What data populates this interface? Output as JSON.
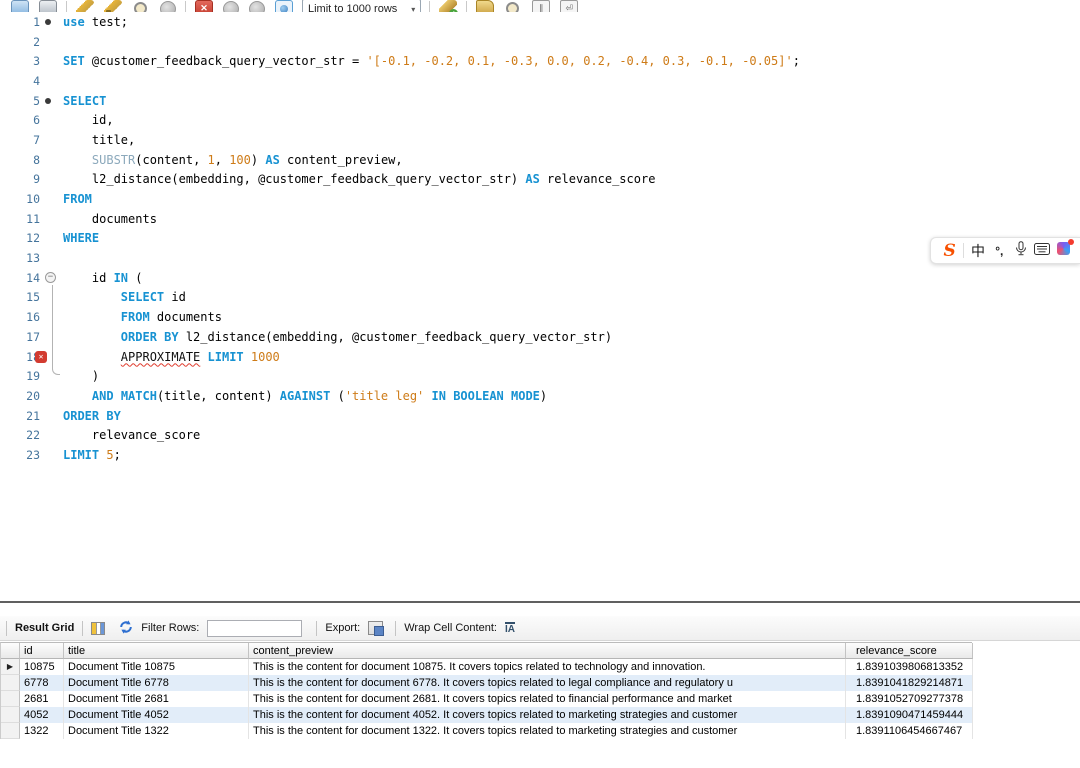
{
  "top_toolbar": {
    "limit_label": "Limit to 1000 rows",
    "icons": [
      {
        "name": "open-script-icon",
        "kind": "doc"
      },
      {
        "name": "save-script-icon",
        "kind": "floppy"
      },
      {
        "kind": "sep"
      },
      {
        "name": "execute-script-icon",
        "kind": "pencil"
      },
      {
        "name": "execute-current-statement-icon",
        "kind": "pencil2"
      },
      {
        "name": "explain-plan-icon",
        "kind": "maglight"
      },
      {
        "name": "stop-query-icon",
        "kind": "circle-gray"
      },
      {
        "kind": "sep"
      },
      {
        "name": "toggle-stop-on-error-icon",
        "kind": "red-grid"
      },
      {
        "name": "commit-icon",
        "kind": "circle-gray"
      },
      {
        "name": "rollback-icon",
        "kind": "circle-gray"
      },
      {
        "name": "toggle-autocommit-icon",
        "kind": "autocommit"
      },
      {
        "kind": "dropdown"
      },
      {
        "kind": "sep"
      },
      {
        "name": "new-snippet-icon",
        "kind": "wand"
      },
      {
        "kind": "sep"
      },
      {
        "name": "beautify-script-icon",
        "kind": "broom"
      },
      {
        "name": "find-icon",
        "kind": "magnify"
      },
      {
        "name": "invisible-chars-icon",
        "kind": "sqicon",
        "glyph": "∥"
      },
      {
        "name": "wrap-text-icon",
        "kind": "sqicon",
        "glyph": "⏎"
      }
    ]
  },
  "editor": {
    "lines": [
      {
        "n": "1",
        "m": "stmt",
        "seg": [
          [
            "k",
            "use"
          ],
          [
            "p",
            " test;"
          ]
        ]
      },
      {
        "n": "2",
        "m": "",
        "seg": []
      },
      {
        "n": "3",
        "m": "",
        "seg": [
          [
            "k",
            "SET"
          ],
          [
            "p",
            " @customer_feedback_query_vector_str = "
          ],
          [
            "s",
            "'[-0.1, -0.2, 0.1, -0.3, 0.0, 0.2, -0.4, 0.3, -0.1, -0.05]'"
          ],
          [
            "p",
            ";"
          ]
        ]
      },
      {
        "n": "4",
        "m": "",
        "seg": []
      },
      {
        "n": "5",
        "m": "stmt",
        "seg": [
          [
            "k",
            "SELECT"
          ]
        ]
      },
      {
        "n": "6",
        "m": "",
        "seg": [
          [
            "p",
            "    id,"
          ]
        ]
      },
      {
        "n": "7",
        "m": "",
        "seg": [
          [
            "p",
            "    title,"
          ]
        ]
      },
      {
        "n": "8",
        "m": "",
        "seg": [
          [
            "p",
            "    "
          ],
          [
            "f",
            "SUBSTR"
          ],
          [
            "p",
            "(content, "
          ],
          [
            "s",
            "1"
          ],
          [
            "p",
            ", "
          ],
          [
            "s",
            "100"
          ],
          [
            "p",
            ") "
          ],
          [
            "k",
            "AS"
          ],
          [
            "p",
            " content_preview,"
          ]
        ]
      },
      {
        "n": "9",
        "m": "",
        "seg": [
          [
            "p",
            "    l2_distance(embedding, @customer_feedback_query_vector_str) "
          ],
          [
            "k",
            "AS"
          ],
          [
            "p",
            " relevance_score"
          ]
        ]
      },
      {
        "n": "10",
        "m": "",
        "seg": [
          [
            "k",
            "FROM"
          ]
        ]
      },
      {
        "n": "11",
        "m": "",
        "seg": [
          [
            "p",
            "    documents"
          ]
        ]
      },
      {
        "n": "12",
        "m": "",
        "seg": [
          [
            "k",
            "WHERE"
          ]
        ]
      },
      {
        "n": "13",
        "m": "",
        "seg": []
      },
      {
        "n": "14",
        "m": "fold",
        "seg": [
          [
            "p",
            "    id "
          ],
          [
            "k",
            "IN"
          ],
          [
            "p",
            " ("
          ]
        ]
      },
      {
        "n": "15",
        "m": "",
        "seg": [
          [
            "p",
            "        "
          ],
          [
            "k",
            "SELECT"
          ],
          [
            "p",
            " id"
          ]
        ]
      },
      {
        "n": "16",
        "m": "",
        "seg": [
          [
            "p",
            "        "
          ],
          [
            "k",
            "FROM"
          ],
          [
            "p",
            " documents"
          ]
        ]
      },
      {
        "n": "17",
        "m": "",
        "seg": [
          [
            "p",
            "        "
          ],
          [
            "k",
            "ORDER BY"
          ],
          [
            "p",
            " l2_distance(embedding, @customer_feedback_query_vector_str)"
          ]
        ]
      },
      {
        "n": "18",
        "m": "error",
        "seg": [
          [
            "p",
            "        "
          ],
          [
            "e",
            "APPROXIMATE"
          ],
          [
            "p",
            " "
          ],
          [
            "k",
            "LIMIT"
          ],
          [
            "p",
            " "
          ],
          [
            "s",
            "1000"
          ]
        ]
      },
      {
        "n": "19",
        "m": "",
        "seg": [
          [
            "p",
            "    )"
          ]
        ]
      },
      {
        "n": "20",
        "m": "",
        "seg": [
          [
            "p",
            "    "
          ],
          [
            "k",
            "AND"
          ],
          [
            "p",
            " "
          ],
          [
            "k",
            "MATCH"
          ],
          [
            "p",
            "(title, content) "
          ],
          [
            "k",
            "AGAINST"
          ],
          [
            "p",
            " ("
          ],
          [
            "s",
            "'title leg'"
          ],
          [
            "p",
            " "
          ],
          [
            "k",
            "IN BOOLEAN MODE"
          ],
          [
            "p",
            ")"
          ]
        ]
      },
      {
        "n": "21",
        "m": "",
        "seg": [
          [
            "k",
            "ORDER BY"
          ]
        ]
      },
      {
        "n": "22",
        "m": "",
        "seg": [
          [
            "p",
            "    relevance_score"
          ]
        ]
      },
      {
        "n": "23",
        "m": "",
        "seg": [
          [
            "k",
            "LIMIT"
          ],
          [
            "p",
            " "
          ],
          [
            "s",
            "5"
          ],
          [
            "p",
            ";"
          ]
        ]
      }
    ],
    "colors": {
      "keyword": "#1792d2",
      "function": "#8ca9bc",
      "literal": "#ce7b17",
      "error_underline": "#e03c2e",
      "line_number": "#45749c"
    }
  },
  "ime_bar": {
    "logo": "S",
    "chinese_mode": "中",
    "punctuation_mode": "°,"
  },
  "result_toolbar": {
    "title": "Result Grid",
    "filter_label": "Filter Rows:",
    "filter_value": "",
    "export_label": "Export:",
    "wrap_label": "Wrap Cell Content:"
  },
  "result_grid": {
    "columns": [
      "id",
      "title",
      "content_preview",
      "relevance_score"
    ],
    "rows": [
      [
        "10875",
        "Document Title 10875",
        "This is the content for document 10875. It covers topics related to technology and innovation.",
        "1.8391039806813352"
      ],
      [
        "6778",
        "Document Title 6778",
        "This is the content for document 6778. It covers topics related to legal compliance and regulatory u",
        "1.8391041829214871"
      ],
      [
        "2681",
        "Document Title 2681",
        "This is the content for document 2681. It covers topics related to financial performance and market",
        "1.8391052709277378"
      ],
      [
        "4052",
        "Document Title 4052",
        "This is the content for document 4052. It covers topics related to marketing strategies and customer",
        "1.8391090471459444"
      ],
      [
        "1322",
        "Document Title 1322",
        "This is the content for document 1322. It covers topics related to marketing strategies and customer",
        "1.8391106454667467"
      ]
    ],
    "selected_row_index": 0
  }
}
